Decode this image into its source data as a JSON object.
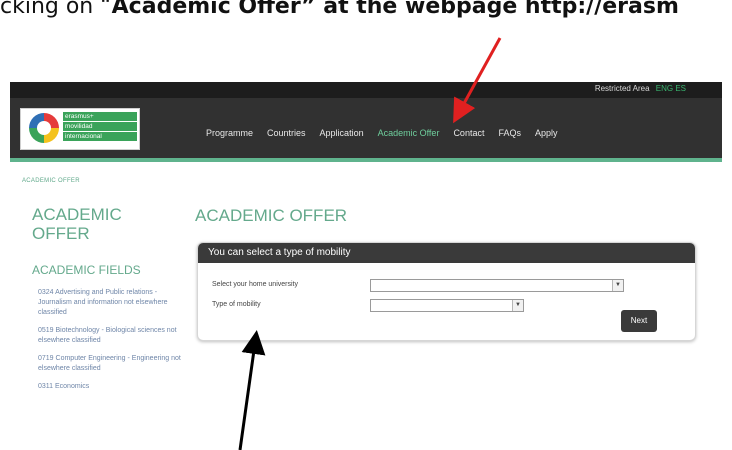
{
  "caption": {
    "prefix": "cking on “",
    "bold": "Academic Offer” at the webpage http://erasm"
  },
  "topbar": {
    "restricted_label": "Restricted Area",
    "restricted_value": "ENG  ES"
  },
  "logo": {
    "lines": [
      "erasmus+",
      "movilidad",
      "internacional"
    ]
  },
  "nav": {
    "items": [
      "Programme",
      "Countries",
      "Application",
      "Academic Offer",
      "Contact",
      "FAQs",
      "Apply"
    ],
    "active_index": 3
  },
  "breadcrumb": "ACADEMIC OFFER",
  "sidebar": {
    "title": "ACADEMIC OFFER",
    "fields_heading": "ACADEMIC FIELDS",
    "fields": [
      "0324 Advertising and Public relations - Journalism and information not elsewhere classified",
      "0519 Biotechnology - Biological sciences not elsewhere classified",
      "0719 Computer Engineering - Engineering not elsewhere classified",
      "0311 Economics"
    ]
  },
  "main": {
    "title": "ACADEMIC OFFER",
    "panel_heading": "You can select a type of mobility",
    "university_label": "Select your home university",
    "mobility_label": "Type of mobility",
    "next_button": "Next"
  },
  "colors": {
    "accent": "#64a98c",
    "arrow_red": "#e02020",
    "arrow_black": "#000000"
  }
}
